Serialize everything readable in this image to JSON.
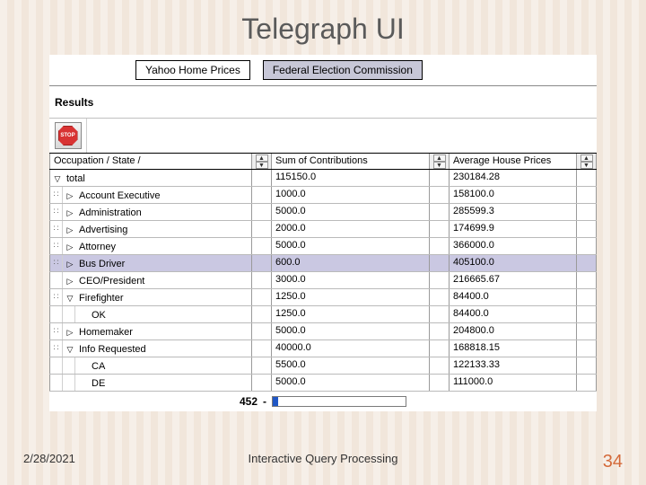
{
  "slide": {
    "title": "Telegraph UI",
    "date": "2/28/2021",
    "footer": "Interactive Query Processing",
    "page": "34"
  },
  "tabs": [
    {
      "label": "Yahoo Home Prices",
      "active": false
    },
    {
      "label": "Federal Election Commission",
      "active": true
    }
  ],
  "results_label": "Results",
  "stop_label": "STOP",
  "columns": [
    "Occupation / State /",
    "Sum of  Contributions",
    "Average House Prices"
  ],
  "rows": [
    {
      "indent": 0,
      "marker": "▽",
      "dots": false,
      "label": "total",
      "c1": "115150.0",
      "c2": "230184.28",
      "sel": false
    },
    {
      "indent": 1,
      "marker": "▷",
      "dots": true,
      "label": "Account Executive",
      "c1": "1000.0",
      "c2": "158100.0",
      "sel": false
    },
    {
      "indent": 1,
      "marker": "▷",
      "dots": true,
      "label": "Administration",
      "c1": "5000.0",
      "c2": "285599.3",
      "sel": false
    },
    {
      "indent": 1,
      "marker": "▷",
      "dots": true,
      "label": "Advertising",
      "c1": "2000.0",
      "c2": "174699.9",
      "sel": false
    },
    {
      "indent": 1,
      "marker": "▷",
      "dots": true,
      "label": "Attorney",
      "c1": "5000.0",
      "c2": "366000.0",
      "sel": false
    },
    {
      "indent": 1,
      "marker": "▷",
      "dots": true,
      "label": "Bus Driver",
      "c1": "600.0",
      "c2": "405100.0",
      "sel": true
    },
    {
      "indent": 1,
      "marker": "▷",
      "dots": false,
      "label": "CEO/President",
      "c1": "3000.0",
      "c2": "216665.67",
      "sel": false
    },
    {
      "indent": 1,
      "marker": "▽",
      "dots": true,
      "label": "Firefighter",
      "c1": "1250.0",
      "c2": "84400.0",
      "sel": false
    },
    {
      "indent": 2,
      "marker": "",
      "dots": false,
      "label": "OK",
      "c1": "1250.0",
      "c2": "84400.0",
      "sel": false
    },
    {
      "indent": 1,
      "marker": "▷",
      "dots": true,
      "label": "Homemaker",
      "c1": "5000.0",
      "c2": "204800.0",
      "sel": false
    },
    {
      "indent": 1,
      "marker": "▽",
      "dots": true,
      "label": "Info Requested",
      "c1": "40000.0",
      "c2": "168818.15",
      "sel": false
    },
    {
      "indent": 2,
      "marker": "",
      "dots": false,
      "label": "CA",
      "c1": "5500.0",
      "c2": "122133.33",
      "sel": false
    },
    {
      "indent": 2,
      "marker": "",
      "dots": false,
      "label": "DE",
      "c1": "5000.0",
      "c2": "111000.0",
      "sel": false
    }
  ],
  "progress": {
    "count": "452",
    "dash": "-"
  }
}
